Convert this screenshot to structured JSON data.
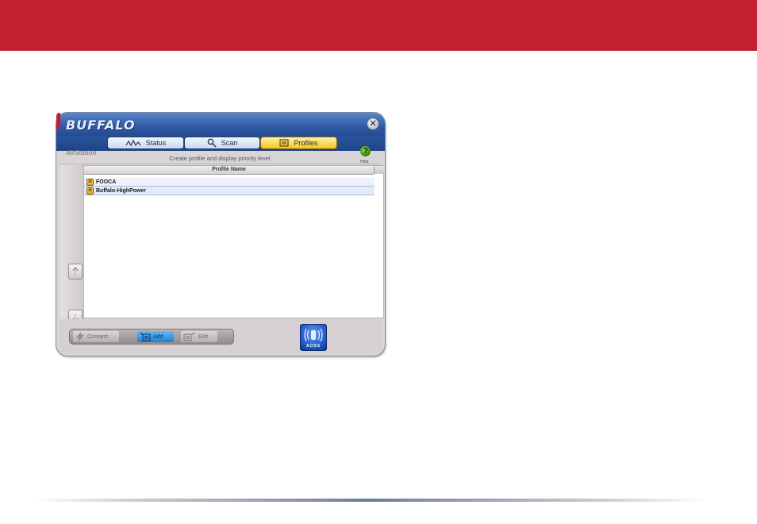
{
  "window": {
    "brand": "BUFFALO",
    "close_symbol": "✕",
    "airstation_logo": "AirStation",
    "instructions": "Create profile and display priority level.",
    "help_symbol": "?",
    "help_label": "Help"
  },
  "tabs": [
    {
      "label": "Status",
      "icon": "activity-icon"
    },
    {
      "label": "Scan",
      "icon": "magnifier-icon"
    },
    {
      "label": "Profiles",
      "icon": "document-icon",
      "selected": true
    }
  ],
  "profile_list": {
    "header": "Profile Name",
    "rows": [
      "FOOCA",
      "Buffalo-HighPower"
    ]
  },
  "actions": {
    "connect": "Connect",
    "add": "Add",
    "edit": "Edit",
    "aoss": "AOSS"
  },
  "colors": {
    "top_bar": "#c1202e",
    "title_bar": "#2e5aa5",
    "selected_tab": "#f4c51d"
  }
}
